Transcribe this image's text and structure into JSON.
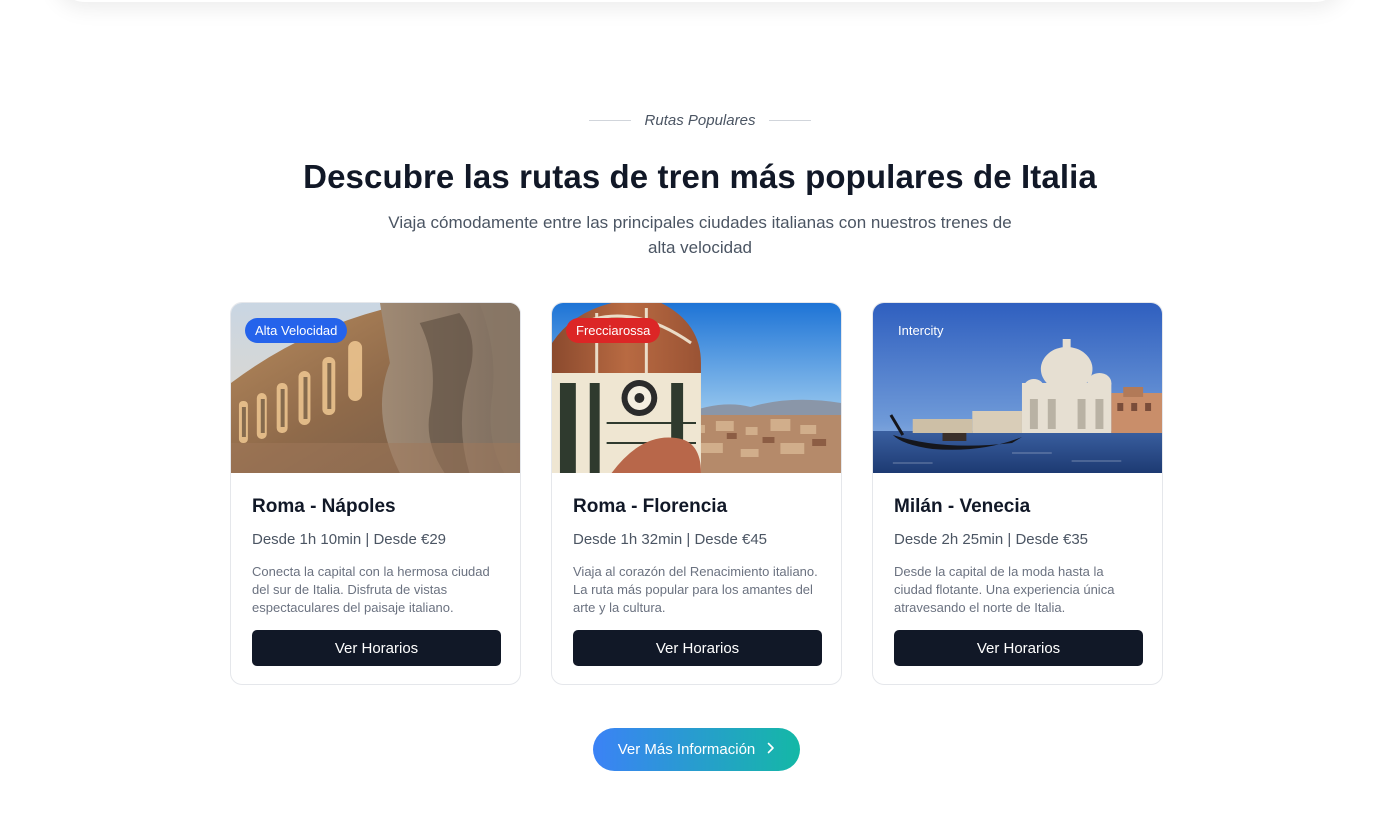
{
  "section": {
    "eyebrow": "Rutas Populares",
    "title": "Descubre las rutas de tren más populares de Italia",
    "subtitle": "Viaja cómodamente entre las principales ciudades italianas con nuestros trenes de alta velocidad"
  },
  "cards": [
    {
      "badge": "Alta Velocidad",
      "route": "Roma - Nápoles",
      "meta": "Desde 1h 10min | Desde €29",
      "description": "Conecta la capital con la hermosa ciudad del sur de Italia. Disfruta de vistas espectaculares del paisaje italiano.",
      "button": "Ver Horarios"
    },
    {
      "badge": "Frecciarossa",
      "route": "Roma - Florencia",
      "meta": "Desde 1h 32min | Desde €45",
      "description": "Viaja al corazón del Renacimiento italiano. La ruta más popular para los amantes del arte y la cultura.",
      "button": "Ver Horarios"
    },
    {
      "badge": "Intercity",
      "route": "Milán - Venecia",
      "meta": "Desde 2h 25min | Desde €35",
      "description": "Desde la capital de la moda hasta la ciudad flotante. Una experiencia única atravesando el norte de Italia.",
      "button": "Ver Horarios"
    }
  ],
  "cta": {
    "label": "Ver Más Información",
    "icon": "chevron-right-icon"
  },
  "colors": {
    "badge_alta_velocidad": "#2563eb",
    "badge_frecciarossa": "#dc2626",
    "button_dark": "#111827",
    "cta_gradient_start": "#3b82f6",
    "cta_gradient_end": "#14b8a6"
  }
}
